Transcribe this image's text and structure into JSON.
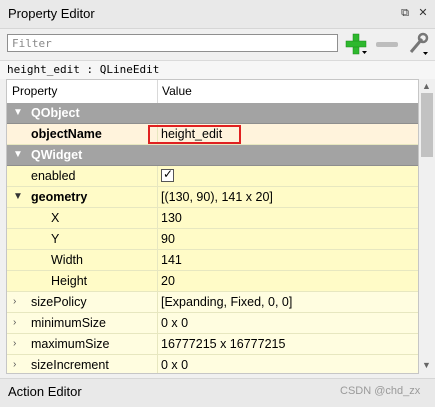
{
  "window": {
    "title": "Property Editor",
    "float_icon": "⧉",
    "close_icon": "✕"
  },
  "toolbar": {
    "filter_placeholder": "Filter"
  },
  "object_info": "height_edit : QLineEdit",
  "table": {
    "col_property": "Property",
    "col_value": "Value"
  },
  "rows": [
    {
      "name": "QObject"
    },
    {
      "name": "objectName",
      "value": "height_edit"
    },
    {
      "name": "QWidget"
    },
    {
      "name": "enabled",
      "checked": true
    },
    {
      "name": "geometry",
      "value": "[(130, 90), 141 x 20]"
    },
    {
      "name": "X",
      "value": "130"
    },
    {
      "name": "Y",
      "value": "90"
    },
    {
      "name": "Width",
      "value": "141"
    },
    {
      "name": "Height",
      "value": "20"
    },
    {
      "name": "sizePolicy",
      "value": "[Expanding, Fixed, 0, 0]"
    },
    {
      "name": "minimumSize",
      "value": "0 x 0"
    },
    {
      "name": "maximumSize",
      "value": "16777215 x 16777215"
    },
    {
      "name": "sizeIncrement",
      "value": "0 x 0"
    }
  ],
  "action_editor": {
    "title": "Action Editor",
    "float_icon": "⧉",
    "close_icon": "✕"
  },
  "watermark": "CSDN @chd_zx"
}
